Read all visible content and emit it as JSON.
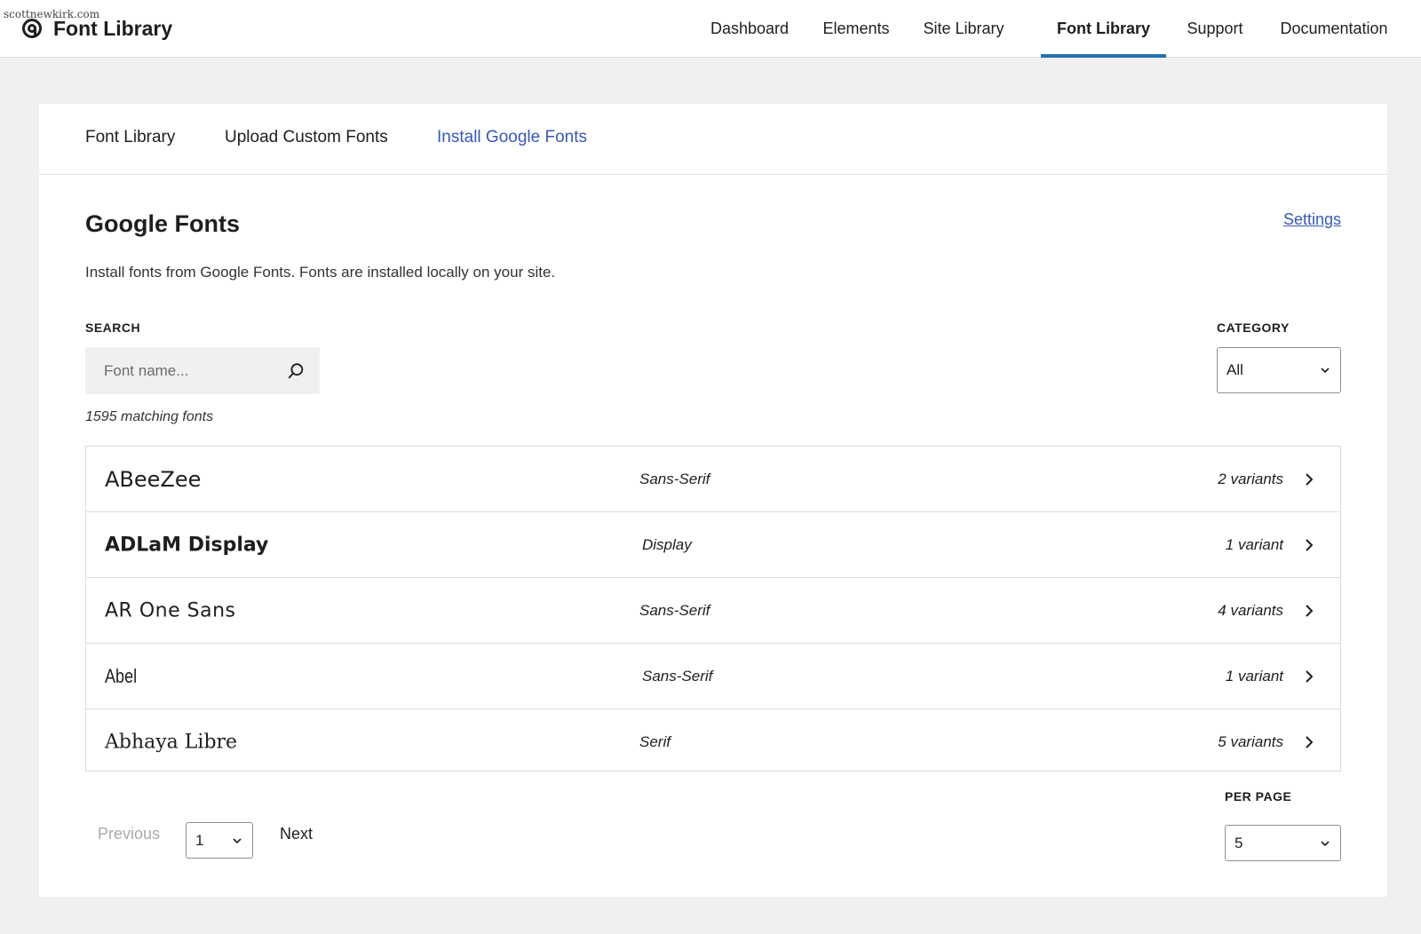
{
  "watermark": "scottnewkirk.com",
  "brand": {
    "name": "Font Library",
    "logo_icon": "at-sign-logo-icon"
  },
  "topnav": {
    "items": [
      {
        "label": "Dashboard",
        "active": false
      },
      {
        "label": "Elements",
        "active": false
      },
      {
        "label": "Site Library",
        "active": false
      },
      {
        "label": "Font Library",
        "active": true
      },
      {
        "label": "Support",
        "active": false
      },
      {
        "label": "Documentation",
        "active": false
      }
    ],
    "accent_color": "#2271b1"
  },
  "subtabs": [
    {
      "label": "Font Library",
      "active": false
    },
    {
      "label": "Upload Custom Fonts",
      "active": false
    },
    {
      "label": "Install Google Fonts",
      "active": true
    }
  ],
  "section": {
    "title": "Google Fonts",
    "settings_link": "Settings",
    "description": "Install fonts from Google Fonts. Fonts are installed locally on your site."
  },
  "search": {
    "label": "SEARCH",
    "placeholder": "Font name...",
    "value": "",
    "icon": "search-icon"
  },
  "category": {
    "label": "CATEGORY",
    "selected": "All"
  },
  "matching_count": "1595 matching fonts",
  "fonts": [
    {
      "name": "ABeeZee",
      "category": "Sans-Serif",
      "variants": "2 variants"
    },
    {
      "name": "ADLaM Display",
      "category": "Display",
      "variants": "1 variant"
    },
    {
      "name": "AR One Sans",
      "category": "Sans-Serif",
      "variants": "4 variants"
    },
    {
      "name": "Abel",
      "category": "Sans-Serif",
      "variants": "1 variant"
    },
    {
      "name": "Abhaya Libre",
      "category": "Serif",
      "variants": "5 variants"
    }
  ],
  "pagination": {
    "previous_label": "Previous",
    "page_selected": "1",
    "next_label": "Next",
    "per_page_label": "PER PAGE",
    "per_page_selected": "5"
  },
  "colors": {
    "link_blue": "#3858b6",
    "page_bg": "#f0f0f0",
    "disabled_text": "#a7aaad"
  }
}
